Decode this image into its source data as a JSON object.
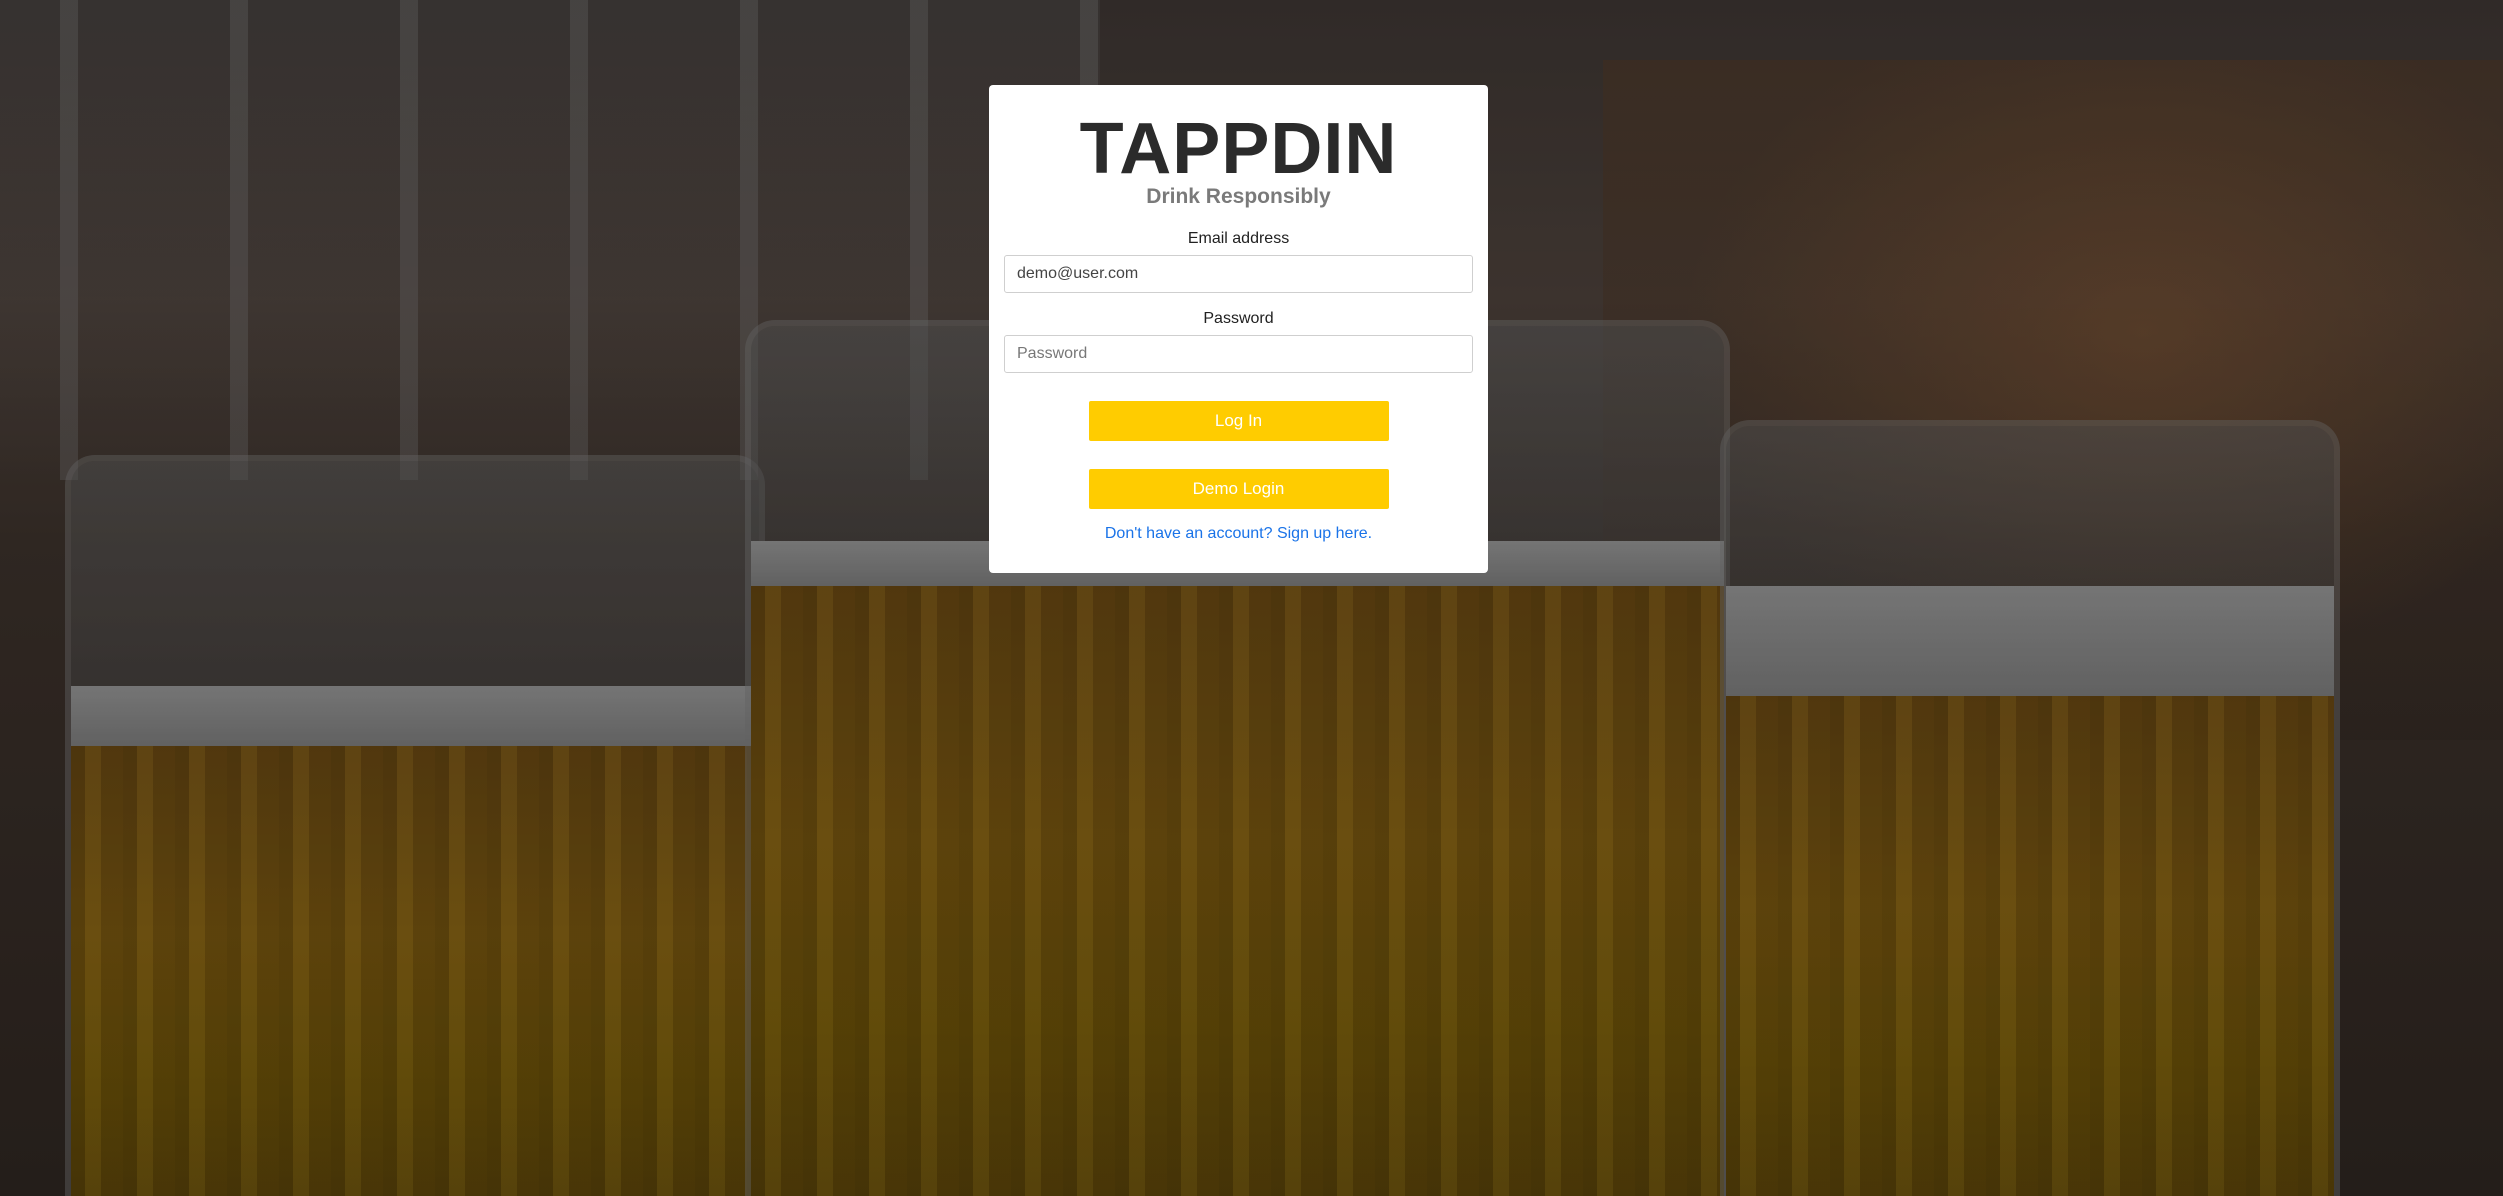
{
  "brand": {
    "logo": "TAPPDIN",
    "tagline": "Drink Responsibly"
  },
  "form": {
    "email_label": "Email address",
    "email_value": "demo@user.com",
    "email_placeholder": "",
    "password_label": "Password",
    "password_value": "",
    "password_placeholder": "Password",
    "login_label": "Log In",
    "demo_label": "Demo Login",
    "signup_link": "Don't have an account? Sign up here."
  },
  "colors": {
    "accent": "#ffcc00",
    "link": "#1a73e8",
    "logo": "#2b2b2b",
    "tagline": "#7a7a7a"
  }
}
